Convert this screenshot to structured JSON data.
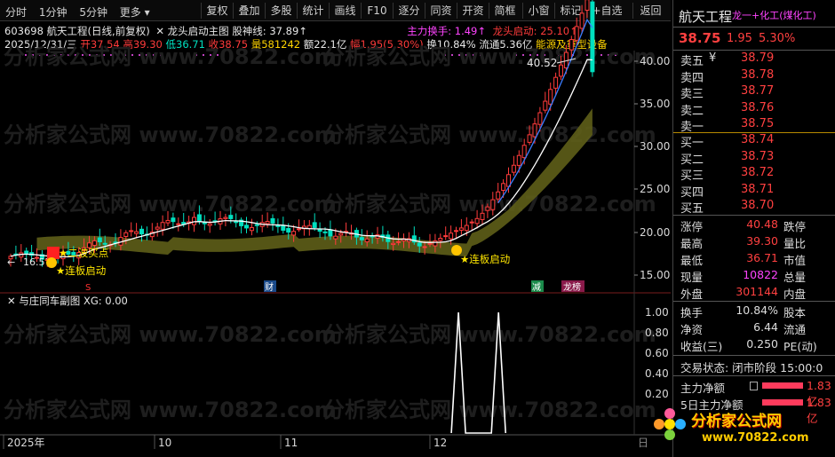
{
  "toolbar": {
    "left_items": [
      "分时",
      "1分钟",
      "5分钟",
      "更多 ▾"
    ],
    "buttons": [
      "复权",
      "叠加",
      "多股",
      "统计",
      "画线",
      "F10",
      "逐分",
      "同资",
      "开资",
      "简框",
      "小窗",
      "标记",
      "+自选",
      "返回"
    ]
  },
  "chart": {
    "code_line": {
      "code": "603698",
      "name": "航天工程(日线,前复权)",
      "indicator": "龙头启动主图",
      "gushen_label": "股神线:",
      "gushen_value": "37.89↑",
      "zhuli_label": "主力换手:",
      "zhuli_value": "1.49↑",
      "longtou_label": "龙头启动:",
      "longtou_value": "25.10↑"
    },
    "quote_line": {
      "date": "2025/12/31/三",
      "open": "开37.54",
      "high": "高39.30",
      "low": "低36.71",
      "close": "收38.75",
      "volume": "量581242",
      "amount": "额22.1亿",
      "amplitude": "幅1.95(5.30%)",
      "turnover": "换10.84%",
      "float": "流通5.36亿",
      "sector": "能源及重型设备"
    },
    "price_axis": [
      "40.00",
      "35.00",
      "30.00",
      "25.00",
      "20.00",
      "15.00"
    ],
    "annotations": {
      "high_marker": "40.52",
      "low_marker": "16.57",
      "buy2": "★二波买点",
      "start1": "★连板启动",
      "start2": "★连板启动",
      "event_s": "S",
      "event_cai": "财",
      "event_jian": "减",
      "event_long": "龙榜"
    },
    "sub_title": "与庄同车副图",
    "sub_value": "XG: 0.00",
    "sub_axis": [
      "1.00",
      "0.80",
      "0.60",
      "0.40",
      "0.20"
    ],
    "x_axis": [
      "2025年",
      "10",
      "11",
      "12"
    ],
    "x_axis_right": "日"
  },
  "panel": {
    "stock_name": "航天工程",
    "sector_tag": "龙一+化工(煤化工)",
    "price": "38.75",
    "change": "1.95",
    "change_pct": "5.30%",
    "asks": [
      {
        "label": "卖五",
        "mark": "¥",
        "price": "38.79"
      },
      {
        "label": "卖四",
        "mark": "",
        "price": "38.78"
      },
      {
        "label": "卖三",
        "mark": "",
        "price": "38.77"
      },
      {
        "label": "卖二",
        "mark": "",
        "price": "38.76"
      },
      {
        "label": "卖一",
        "mark": "",
        "price": "38.75"
      }
    ],
    "bids": [
      {
        "label": "买一",
        "price": "38.74"
      },
      {
        "label": "买二",
        "price": "38.73"
      },
      {
        "label": "买三",
        "price": "38.72"
      },
      {
        "label": "买四",
        "price": "38.71"
      },
      {
        "label": "买五",
        "price": "38.70"
      }
    ],
    "stats": [
      {
        "l1": "涨停",
        "v1": "40.48",
        "l2": "跌停",
        "color": "#ff4040"
      },
      {
        "l1": "最高",
        "v1": "39.30",
        "l2": "量比",
        "color": "#ff4040"
      },
      {
        "l1": "最低",
        "v1": "36.71",
        "l2": "市值",
        "color": "#ff4040"
      },
      {
        "l1": "现量",
        "v1": "10822",
        "l2": "总量",
        "color": "#ff44ff"
      },
      {
        "l1": "外盘",
        "v1": "301144",
        "l2": "内盘",
        "color": "#ff4040"
      }
    ],
    "stats2": [
      {
        "l1": "换手",
        "v1": "10.84%",
        "l2": "股本"
      },
      {
        "l1": "净资",
        "v1": "6.44",
        "l2": "流通"
      },
      {
        "l1": "收益(三)",
        "v1": "0.250",
        "l2": "PE(动)"
      }
    ],
    "trade_status": "交易状态: 闭市阶段 15:00:0",
    "main_net": "主力净额",
    "main_net_val": "1.83亿",
    "main_net5": "5日主力净额",
    "main_net5_val": "1.83亿"
  },
  "watermark": {
    "text": "分析家公式网 www.70822.com",
    "logo_cn": "分析家公式网",
    "logo_url": "www.70822.com"
  },
  "colors": {
    "up": "#ff3b3b",
    "down": "#00e0c0",
    "band": "#6b6b1a",
    "curve": "#ffffff",
    "signal": "#ffffff"
  },
  "chart_data": {
    "type": "line",
    "series": [
      {
        "values": [
          0,
          0,
          0,
          0,
          0,
          0,
          0,
          0,
          0,
          0,
          0,
          0,
          0,
          0,
          0,
          0,
          0,
          0,
          0,
          0,
          0,
          0,
          1,
          0,
          1,
          0,
          0,
          0,
          0,
          0,
          0
        ]
      }
    ],
    "ylim": [
      0,
      1.0
    ]
  }
}
